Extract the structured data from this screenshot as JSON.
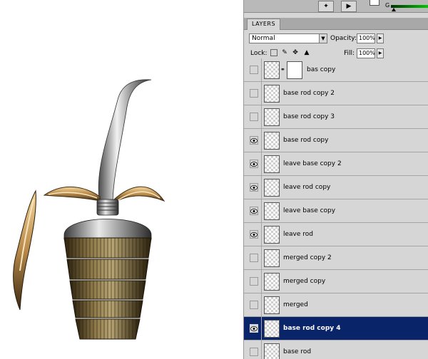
{
  "panel": {
    "tab_label": "LAYERS",
    "top_label_g": "G",
    "blend_mode": "Normal",
    "opacity_label": "Opacity:",
    "opacity_value": "100%",
    "lock_label": "Lock:",
    "fill_label": "Fill:",
    "fill_value": "100%"
  },
  "layers": [
    {
      "name": "bas copy",
      "visible": false,
      "selected": false,
      "has_mask": true
    },
    {
      "name": "base rod copy 2",
      "visible": false,
      "selected": false,
      "has_mask": false
    },
    {
      "name": "base rod copy 3",
      "visible": false,
      "selected": false,
      "has_mask": false
    },
    {
      "name": "base rod copy",
      "visible": true,
      "selected": false,
      "has_mask": false
    },
    {
      "name": "leave base copy 2",
      "visible": true,
      "selected": false,
      "has_mask": false
    },
    {
      "name": "leave rod copy",
      "visible": true,
      "selected": false,
      "has_mask": false
    },
    {
      "name": "leave base copy",
      "visible": true,
      "selected": false,
      "has_mask": false
    },
    {
      "name": "leave rod",
      "visible": true,
      "selected": false,
      "has_mask": false
    },
    {
      "name": "merged copy 2",
      "visible": false,
      "selected": false,
      "has_mask": false
    },
    {
      "name": "merged copy",
      "visible": false,
      "selected": false,
      "has_mask": false
    },
    {
      "name": "merged",
      "visible": false,
      "selected": false,
      "has_mask": false
    },
    {
      "name": "base rod copy 4",
      "visible": true,
      "selected": true,
      "has_mask": false
    },
    {
      "name": "base rod",
      "visible": false,
      "selected": false,
      "has_mask": false
    }
  ],
  "colors": {
    "selection": "#0a246a",
    "panel_bg": "#d6d6d6",
    "metal_gold": "#8a6a30",
    "metal_silver": "#c8c8c8"
  }
}
